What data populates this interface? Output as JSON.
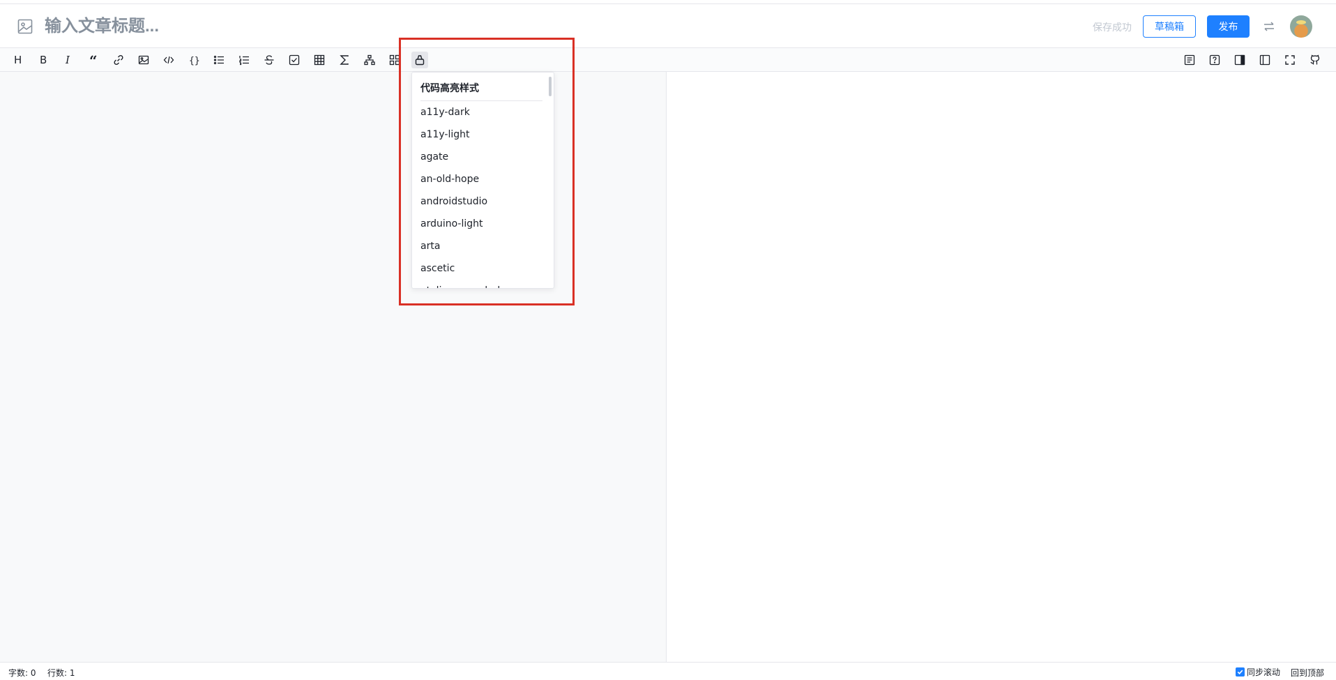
{
  "header": {
    "title_placeholder": "输入文章标题...",
    "save_status": "保存成功",
    "draft_label": "草稿箱",
    "publish_label": "发布"
  },
  "toolbar": {
    "left_icons": [
      "heading-icon",
      "bold-icon",
      "italic-icon",
      "quote-icon",
      "link-icon",
      "image-icon",
      "inline-code-icon",
      "code-block-icon",
      "unordered-list-icon",
      "ordered-list-icon",
      "strikethrough-icon",
      "task-list-icon",
      "table-icon",
      "formula-icon",
      "mermaid-diagram-icon",
      "theme-icon",
      "code-highlight-style-icon"
    ],
    "right_icons": [
      "directory-icon",
      "help-icon",
      "preview-only-icon",
      "editor-only-icon",
      "fullscreen-icon",
      "github-icon"
    ],
    "heading_glyph": "H",
    "bold_glyph": "B",
    "italic_glyph": "I",
    "quote_glyph": "“",
    "code_block_glyph": "{}"
  },
  "dropdown": {
    "title": "代码高亮样式",
    "items": [
      "a11y-dark",
      "a11y-light",
      "agate",
      "an-old-hope",
      "androidstudio",
      "arduino-light",
      "arta",
      "ascetic",
      "atelier-cave-dark"
    ]
  },
  "status": {
    "word_count": "字数: 0",
    "line_count": "行数: 1",
    "sync_scroll": "同步滚动",
    "back_to_top": "回到顶部"
  },
  "colors": {
    "accent": "#1e80ff",
    "highlight_border": "#d93025"
  }
}
